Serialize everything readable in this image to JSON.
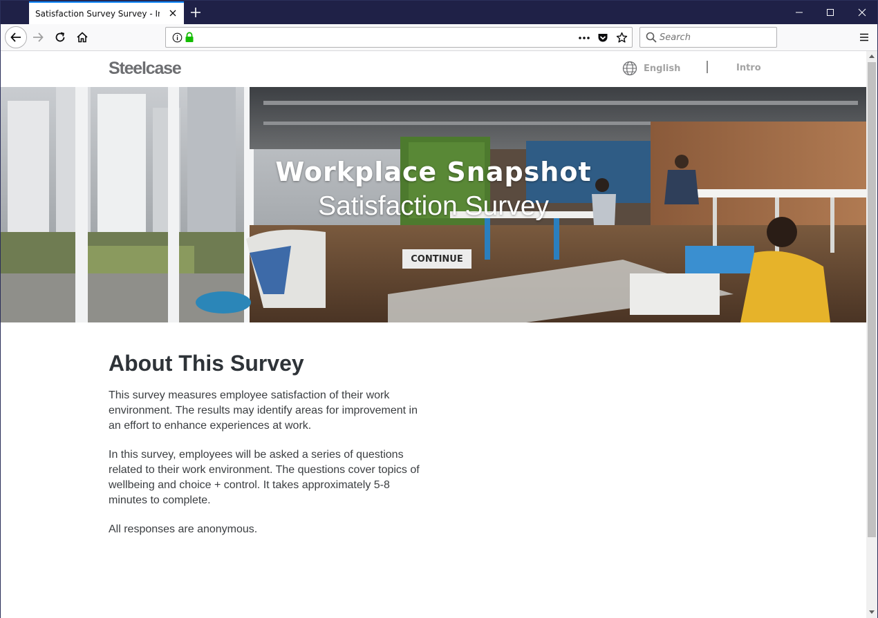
{
  "browser": {
    "tab_title": "Satisfaction Survey Survey - Introdu",
    "search_placeholder": "Search"
  },
  "site": {
    "logo": "Steelcase",
    "language": "English",
    "nav_intro": "Intro"
  },
  "hero": {
    "title": "Workplace Snapshot",
    "subtitle": "Satisfaction Survey",
    "continue_label": "CONTINUE"
  },
  "about": {
    "heading": "About This Survey",
    "paragraphs": [
      "This survey measures employee satisfaction of their work environment. The results may identify areas for improvement in an effort to enhance experiences at work.",
      "In this survey, employees will be asked a series of questions related to their work environment. The questions cover topics of wellbeing and choice + control. It takes approximately 5-8 minutes to complete.",
      "All responses are anonymous."
    ]
  },
  "colors": {
    "titlebar": "#1f2147",
    "tab_accent": "#0a84ff",
    "secure_lock": "#12bc00",
    "heading_text": "#2e3338",
    "nav_gray": "#a3a3a3"
  },
  "icons": [
    "back-arrow-icon",
    "forward-arrow-icon",
    "reload-icon",
    "home-icon",
    "info-icon",
    "lock-icon",
    "more-icon",
    "pocket-icon",
    "bookmark-star-icon",
    "search-icon",
    "menu-icon",
    "globe-icon",
    "close-icon",
    "plus-icon",
    "minimize-icon",
    "maximize-icon"
  ]
}
